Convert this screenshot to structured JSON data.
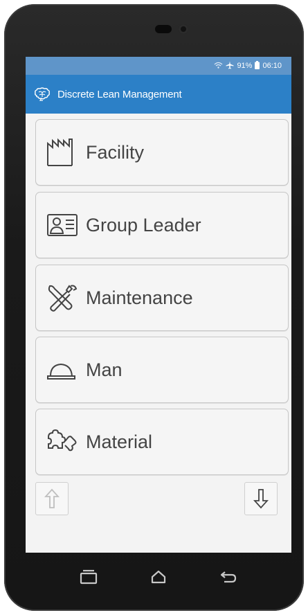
{
  "status_bar": {
    "wifi_icon": "wifi-icon",
    "airplane_icon": "airplane-icon",
    "battery_percent": "91%",
    "battery_icon": "battery-icon",
    "time": "06:10"
  },
  "app_bar": {
    "logo_icon": "brain-logo-icon",
    "title": "Discrete Lean Management",
    "color": "#2c80c7"
  },
  "menu": {
    "items": [
      {
        "label": "Facility",
        "icon": "factory-icon"
      },
      {
        "label": "Group Leader",
        "icon": "id-card-icon"
      },
      {
        "label": "Maintenance",
        "icon": "tools-icon"
      },
      {
        "label": "Man",
        "icon": "hard-hat-icon"
      },
      {
        "label": "Material",
        "icon": "puzzle-icon"
      }
    ]
  },
  "navigation": {
    "up_icon": "arrow-up-icon",
    "down_icon": "arrow-down-icon"
  },
  "soft_keys": {
    "recents_icon": "recents-icon",
    "home_icon": "home-icon",
    "back_icon": "back-icon"
  },
  "colors": {
    "status_bar": "#5f95c9",
    "app_bar": "#2c80c7",
    "button_text": "#444444",
    "screen_bg": "#f3f3f3"
  }
}
